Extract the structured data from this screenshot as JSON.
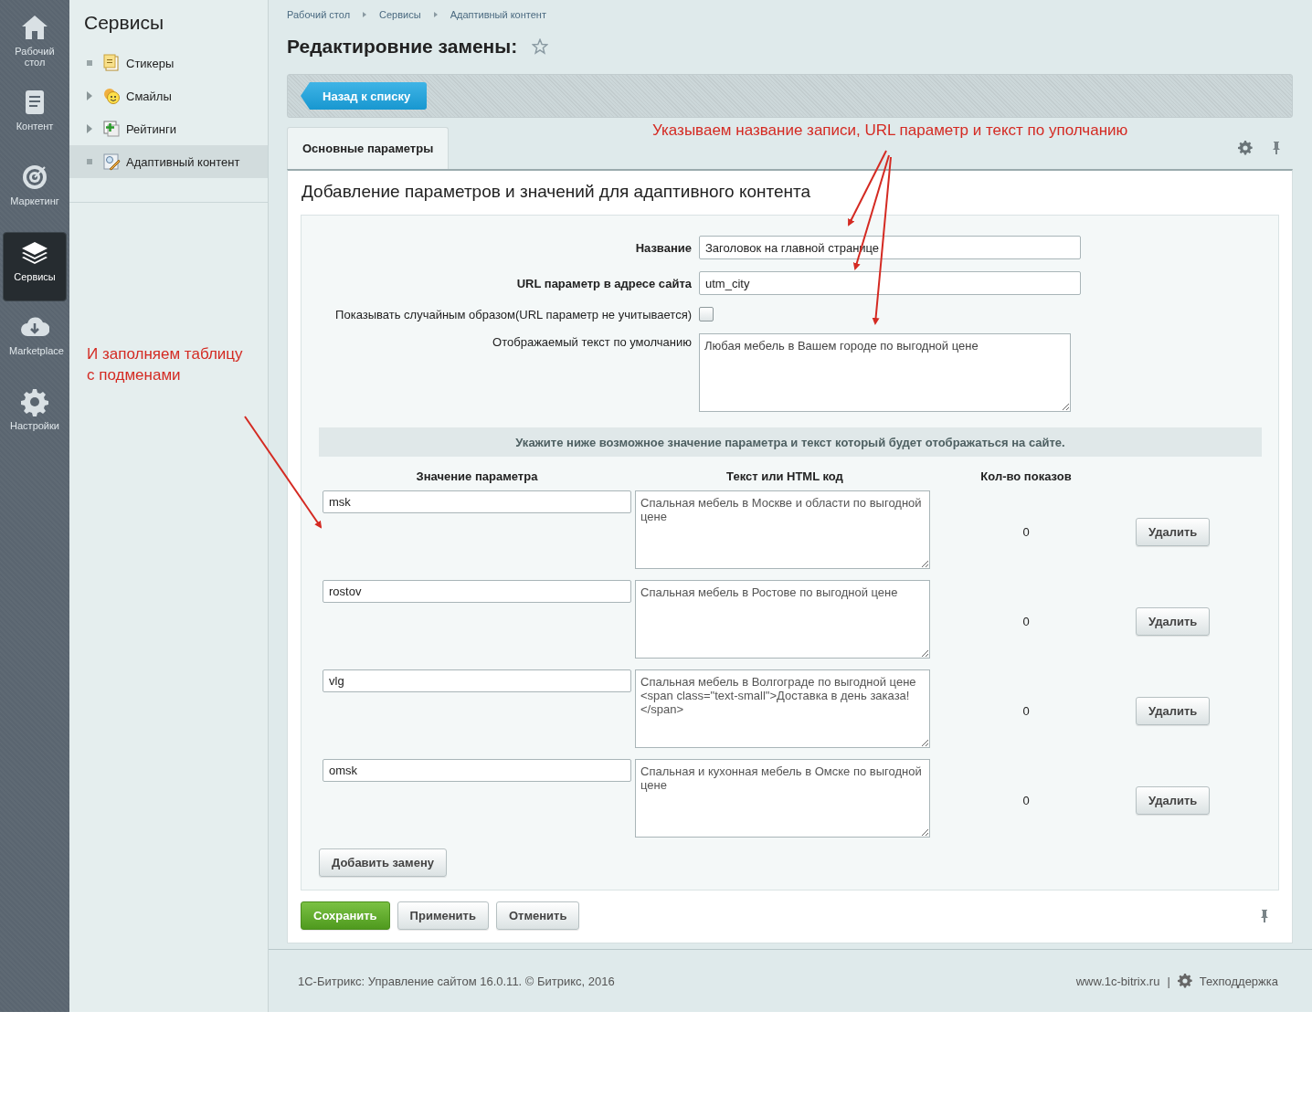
{
  "nav_rail": [
    {
      "label": "Рабочий стол",
      "selected": false
    },
    {
      "label": "Контент",
      "selected": false
    },
    {
      "label": "Маркетинг",
      "selected": false
    },
    {
      "label": "Сервисы",
      "selected": true
    },
    {
      "label": "Marketplace",
      "selected": false
    },
    {
      "label": "Настройки",
      "selected": false
    }
  ],
  "sidebar": {
    "title": "Сервисы",
    "items": [
      {
        "label": "Стикеры",
        "expandable": false,
        "selected": false
      },
      {
        "label": "Смайлы",
        "expandable": true,
        "selected": false
      },
      {
        "label": "Рейтинги",
        "expandable": true,
        "selected": false
      },
      {
        "label": "Адаптивный контент",
        "expandable": false,
        "selected": true
      }
    ]
  },
  "breadcrumbs": [
    "Рабочий стол",
    "Сервисы",
    "Адаптивный контент"
  ],
  "page_title": "Редактировние замены:",
  "back_button": "Назад к списку",
  "tabs": [
    {
      "label": "Основные параметры",
      "selected": true
    }
  ],
  "form": {
    "heading": "Добавление параметров и значений для адаптивного контента",
    "fields": [
      {
        "kind": "text",
        "label": "Название",
        "value": "Заголовок на главной странице"
      },
      {
        "kind": "text",
        "label": "URL параметр в адресе сайта",
        "value": "utm_city"
      },
      {
        "kind": "checkbox",
        "label": "Показывать случайным образом(URL параметр не учитывается)",
        "checked": false
      },
      {
        "kind": "textarea",
        "label": "Отображаемый текст по умолчанию",
        "value": "Любая мебель в Вашем городе по выгодной цене"
      }
    ]
  },
  "notice": "Укажите ниже возможное значение параметра и текст который будет отображаться на сайте.",
  "table": {
    "columns": [
      "Значение параметра",
      "Текст или HTML код",
      "Кол-во показов"
    ],
    "rows": [
      {
        "value": "msk",
        "text": "Спальная мебель в Москве и области по выгодной цене",
        "count": "0",
        "delete": "Удалить"
      },
      {
        "value": "rostov",
        "text": "Спальная мебель в Ростове по выгодной цене",
        "count": "0",
        "delete": "Удалить"
      },
      {
        "value": "vlg",
        "text": "Спальная мебель в Волгограде по выгодной цене <span class=\"text-small\">Доставка в день заказа!</span>",
        "count": "0",
        "delete": "Удалить"
      },
      {
        "value": "omsk",
        "text": "Спальная и кухонная мебель в Омске по выгодной цене",
        "count": "0",
        "delete": "Удалить"
      }
    ]
  },
  "add_button": "Добавить замену",
  "actions": [
    {
      "label": "Сохранить",
      "primary": true
    },
    {
      "label": "Применить",
      "primary": false
    },
    {
      "label": "Отменить",
      "primary": false
    }
  ],
  "footer": {
    "copyright": "1С-Битрикс: Управление сайтом 16.0.11. © Битрикс, 2016",
    "link": "www.1c-bitrix.ru",
    "separator": "|",
    "support": "Техподдержка"
  },
  "annotations": [
    {
      "lines": [
        "Указываем название записи, URL параметр и текст по уполчанию"
      ]
    },
    {
      "lines": [
        "И заполняем таблицу",
        "с подменами"
      ]
    }
  ]
}
